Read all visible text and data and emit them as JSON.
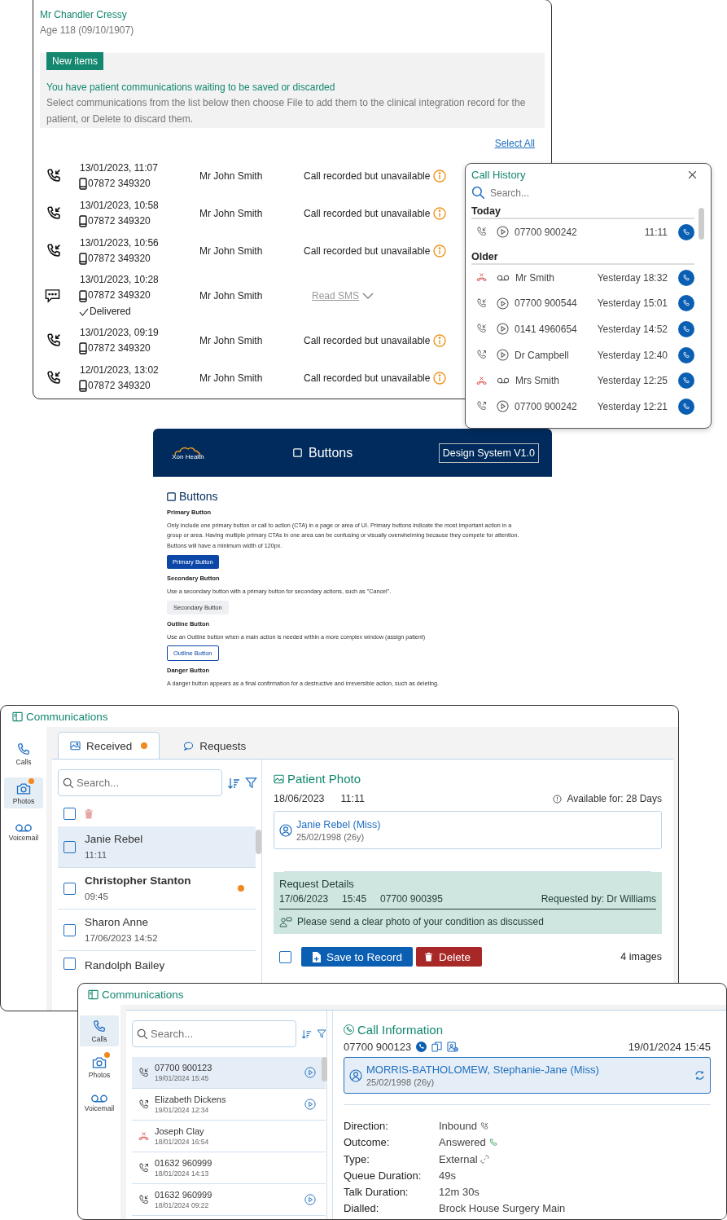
{
  "patient_panel": {
    "name": "Mr Chandler Cressy",
    "age": "Age 118 (09/10/1907)",
    "notice": {
      "badge": "New items",
      "headline": "You have patient communications waiting to be saved or discarded",
      "body": "Select communications from the list below then choose File to add them to the clinical integration record for the patient, or Delete to discard them."
    },
    "select_all": "Select All",
    "items": [
      {
        "kind": "call",
        "date": "13/01/2023, 11:07",
        "number": "07872 349320",
        "contact": "Mr John Smith",
        "status": "Call recorded but unavailable"
      },
      {
        "kind": "call",
        "date": "13/01/2023, 10:58",
        "number": "07872 349320",
        "contact": "Mr John Smith",
        "status": "Call recorded but unavailable"
      },
      {
        "kind": "call",
        "date": "13/01/2023, 10:56",
        "number": "07872 349320",
        "contact": "Mr John Smith",
        "status": "Call recorded but unavailable"
      },
      {
        "kind": "sms",
        "date": "13/01/2023, 10:28",
        "number": "07872 349320",
        "delivery": "Delivered",
        "contact": "Mr John Smith",
        "action": "Read SMS"
      },
      {
        "kind": "call",
        "date": "13/01/2023, 09:19",
        "number": "07872 349320",
        "contact": "Mr John Smith",
        "status": "Call recorded but unavailable"
      },
      {
        "kind": "call",
        "date": "12/01/2023, 13:02",
        "number": "07872 349320",
        "contact": "Mr John Smith",
        "status": "Call recorded but unavailable"
      }
    ]
  },
  "call_history": {
    "title": "Call History",
    "search": {
      "placeholder": "Search..."
    },
    "groups": [
      {
        "heading": "Today",
        "calls": [
          {
            "kind": "inbound",
            "voicemail": false,
            "caller": "07700 900242",
            "time": "11:11"
          }
        ]
      },
      {
        "heading": "Older",
        "calls": [
          {
            "kind": "missed",
            "voicemail": true,
            "caller": "Mr Smith",
            "time": "Yesterday 18:32"
          },
          {
            "kind": "inbound",
            "voicemail": false,
            "caller": "07700 900544",
            "time": "Yesterday 15:01"
          },
          {
            "kind": "inbound",
            "voicemail": false,
            "caller": "0141 4960654",
            "time": "Yesterday 14:52"
          },
          {
            "kind": "outbound",
            "voicemail": false,
            "caller": "Dr Campbell",
            "time": "Yesterday 12:40"
          },
          {
            "kind": "missed",
            "voicemail": true,
            "caller": "Mrs Smith",
            "time": "Yesterday 12:25"
          },
          {
            "kind": "outbound",
            "voicemail": false,
            "caller": "07700 900242",
            "time": "Yesterday 12:21"
          }
        ]
      }
    ]
  },
  "design_system": {
    "logo": "Xon Health",
    "title": "Buttons",
    "version": "Design System V1.0",
    "heading": "Buttons",
    "sections": [
      {
        "heading": "Primary Button",
        "text": "Only include one primary button or call to action (CTA) in a page or area of UI. Primary buttons indicate the most important action in a group or area. Having multiple primary CTAs in one area can be confusing or visually overwhelming because they compete for attention. Buttons will have a minimum width of 120px.",
        "button": {
          "kind": "primary",
          "label": "Primary Button"
        }
      },
      {
        "heading": "Secondary Button",
        "text": "Use a secondary button with a primary button for secondary actions, such as \"Cancel\".",
        "button": {
          "kind": "secondary",
          "label": "Secondary Button"
        }
      },
      {
        "heading": "Outline Button",
        "text": "Use an Outline button when a main action is needed within a more complex window (assign patient)",
        "button": {
          "kind": "outline",
          "label": "Outline  Button"
        }
      },
      {
        "heading": "Danger Button",
        "text": "A danger button appears as a final confirmation for a destructive and irreversible action, such as deleting."
      }
    ]
  },
  "photos_window": {
    "title": "Communications",
    "nav": [
      {
        "kind": "calls",
        "label": "Calls",
        "selected": false,
        "badge": false
      },
      {
        "kind": "photos",
        "label": "Photos",
        "selected": true,
        "badge": true
      },
      {
        "kind": "voicemail",
        "label": "Voicemail",
        "selected": false,
        "badge": false
      }
    ],
    "tabs": [
      {
        "kind": "received",
        "label": "Received",
        "selected": true,
        "badge": true
      },
      {
        "kind": "requests",
        "label": "Requests",
        "selected": false,
        "badge": false
      }
    ],
    "search": {
      "placeholder": "Search..."
    },
    "select_all_checked": false,
    "list": [
      {
        "name": "Janie Rebel",
        "time": "11:11",
        "selected": true,
        "checked": false,
        "unread": false
      },
      {
        "name": "Christopher Stanton",
        "time": "09:45",
        "selected": false,
        "checked": false,
        "unread": true
      },
      {
        "name": "Sharon Anne",
        "time": "17/06/2023 14:52",
        "selected": false,
        "checked": false,
        "unread": false
      },
      {
        "name": "Randolph Bailey",
        "selected": false,
        "checked": false,
        "unread": false
      }
    ],
    "detail": {
      "title": "Patient Photo",
      "date": "18/06/2023",
      "time": "11:11",
      "availability": "Available for: 28 Days",
      "patient": {
        "name": "Janie Rebel (Miss)",
        "dob": "25/02/1998",
        "age": "(26y)"
      },
      "request": {
        "title": "Request Details",
        "date": "17/06/2023",
        "time": "15:45",
        "number": "07700 900395",
        "requested_by": "Requested by: Dr Williams",
        "message": "Please send a clear photo of your condition as discussed"
      },
      "checked": false,
      "save": "Save to Record",
      "delete": "Delete",
      "count": "4 images"
    }
  },
  "calls_window": {
    "title": "Communications",
    "nav": [
      {
        "kind": "calls",
        "label": "Calls",
        "selected": true,
        "badge": false
      },
      {
        "kind": "photos",
        "label": "Photos",
        "selected": false,
        "badge": true
      },
      {
        "kind": "voicemail",
        "label": "Voicemail",
        "selected": false,
        "badge": false
      }
    ],
    "search": {
      "placeholder": "Search..."
    },
    "calls": [
      {
        "kind": "inbound",
        "caller": "07700 900123",
        "time": "19/01/2024 15:45",
        "selected": true,
        "recording": true
      },
      {
        "kind": "outbound",
        "caller": "Elizabeth Dickens",
        "time": "19/01/2024 12:34",
        "selected": false,
        "recording": true
      },
      {
        "kind": "missed",
        "caller": "Joseph Clay",
        "time": "18/01/2024 16:54",
        "selected": false,
        "recording": false
      },
      {
        "kind": "outbound",
        "caller": "01632 960999",
        "time": "18/01/2024 14:13",
        "selected": false,
        "recording": false
      },
      {
        "kind": "inbound",
        "caller": "01632 960999",
        "time": "18/01/2024 09:22",
        "selected": false,
        "recording": true
      }
    ],
    "detail": {
      "title": "Call Information",
      "number": "07700 900123",
      "datetime": "19/01/2024 15:45",
      "patient": {
        "name": "MORRIS-BATHOLOMEW, Stephanie-Jane (Miss)",
        "dob": "25/02/1998",
        "age": "(26y)"
      },
      "fields": [
        {
          "kind": "inbound",
          "label": "Direction:",
          "value": "Inbound"
        },
        {
          "kind": "answered",
          "label": "Outcome:",
          "value": "Answered"
        },
        {
          "kind": "external",
          "label": "Type:",
          "value": "External"
        },
        {
          "kind": "text",
          "label": "Queue Duration:",
          "value": "49s"
        },
        {
          "kind": "text",
          "label": "Talk Duration:",
          "value": "12m 30s"
        },
        {
          "kind": "text",
          "label": "Dialled:",
          "value": "Brock House Surgery Main"
        }
      ]
    }
  }
}
